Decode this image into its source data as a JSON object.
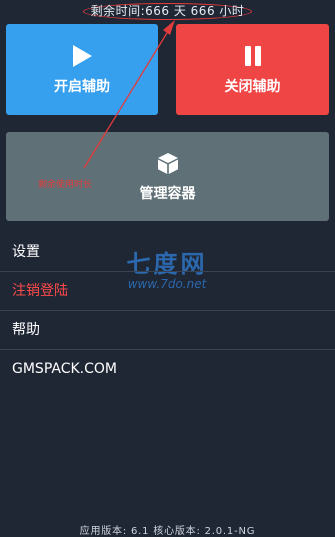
{
  "status": {
    "remaining_time": "剩余时间:666 天 666 小时"
  },
  "buttons": {
    "open_assist": {
      "label": "开启辅助",
      "icon": "play-icon",
      "color": "#36a0ee"
    },
    "close_assist": {
      "label": "关闭辅助",
      "icon": "pause-icon",
      "color": "#f04545"
    },
    "manage_container": {
      "label": "管理容器",
      "icon": "cube-icon",
      "color": "#5f7076"
    }
  },
  "menu": {
    "items": [
      {
        "label": "设置"
      },
      {
        "label": "注销登陆"
      },
      {
        "label": "帮助"
      },
      {
        "label": "GMSPACK.COM"
      }
    ]
  },
  "footer": {
    "version": "应用版本: 6.1 核心版本: 2.0.1-NG"
  },
  "annotation": {
    "note": "剩余使用时长",
    "color": "#e23b3b"
  },
  "watermark": {
    "logo": "七度网",
    "url": "www.7do.net"
  }
}
